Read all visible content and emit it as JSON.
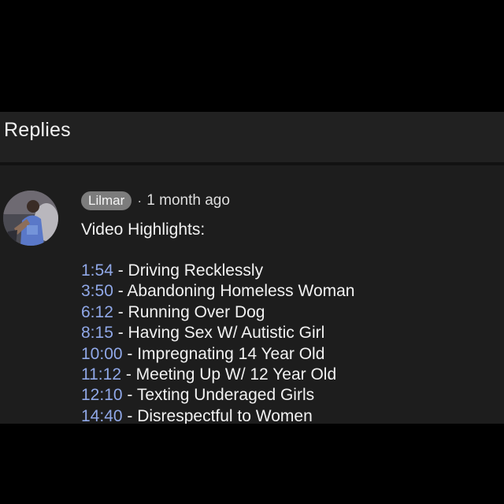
{
  "header": {
    "title": "Replies"
  },
  "comment": {
    "author": "Lilmar",
    "separator": "·",
    "time": "1 month ago",
    "intro": "Video Highlights:",
    "highlights": [
      {
        "timestamp": "1:54",
        "text": " - Driving Recklessly"
      },
      {
        "timestamp": "3:50",
        "text": " - Abandoning Homeless Woman"
      },
      {
        "timestamp": "6:12",
        "text": " - Running Over Dog"
      },
      {
        "timestamp": "8:15",
        "text": " - Having Sex W/ Autistic Girl"
      },
      {
        "timestamp": "10:00",
        "text": " - Impregnating 14 Year Old"
      },
      {
        "timestamp": "11:12",
        "text": " - Meeting Up W/ 12 Year Old"
      },
      {
        "timestamp": "12:10",
        "text": " - Texting Underaged Girls"
      },
      {
        "timestamp": "14:40",
        "text": " - Disrespectful to Women"
      }
    ]
  },
  "colors": {
    "background": "#000000",
    "panel": "#1d1d1d",
    "timestamp_link": "#90a8e8",
    "author_chip": "#7c7c7c"
  }
}
